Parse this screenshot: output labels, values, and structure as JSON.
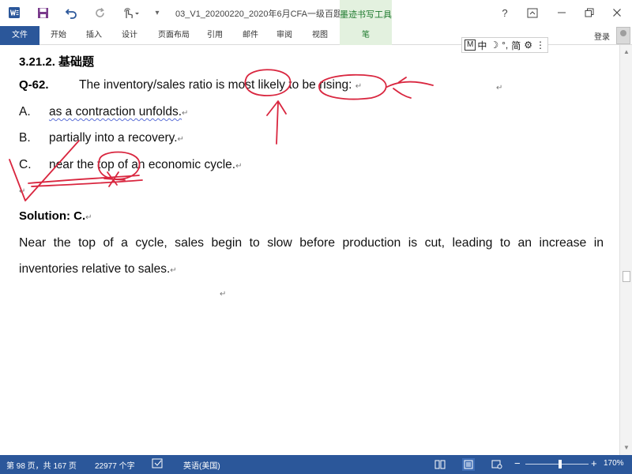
{
  "window": {
    "title": "03_V1_20200220_2020年6月CFA一级百题预...",
    "context_tab": "墨迹书写工具",
    "help": "?",
    "login": "登录"
  },
  "ribbon": {
    "tabs": [
      "文件",
      "开始",
      "插入",
      "设计",
      "页面布局",
      "引用",
      "邮件",
      "审阅",
      "视图",
      "笔"
    ]
  },
  "ime": {
    "mode_box": "M",
    "mode": "中",
    "chars": "简"
  },
  "document": {
    "section": "3.21.2.  基础题",
    "question_label": "Q-62.",
    "question_text": "The inventory/sales ratio is most likely to be rising:",
    "options": [
      {
        "letter": "A.",
        "text": "as a contraction unfolds."
      },
      {
        "letter": "B.",
        "text": "partially into a recovery."
      },
      {
        "letter": "C.",
        "text": "near the top of an economic cycle."
      }
    ],
    "solution_label": "Solution: C.",
    "explanation_line1": "Near the top of a cycle, sales begin to slow before production is cut, leading to an increase in",
    "explanation_line2": "inventories relative to sales.",
    "para_mark": "↵"
  },
  "status": {
    "page": "第 98 页，共 167 页",
    "words": "22977 个字",
    "language": "英语(美国)",
    "zoom": "170%",
    "zoom_level": 0.55
  },
  "colors": {
    "accent": "#2b579a",
    "ink": "#d9263f",
    "pen_tab": "#e3f1df"
  },
  "icons": {
    "app": "word-icon",
    "save": "save-icon",
    "undo": "undo-icon",
    "redo": "redo-icon",
    "touch": "touch-mode-icon"
  }
}
